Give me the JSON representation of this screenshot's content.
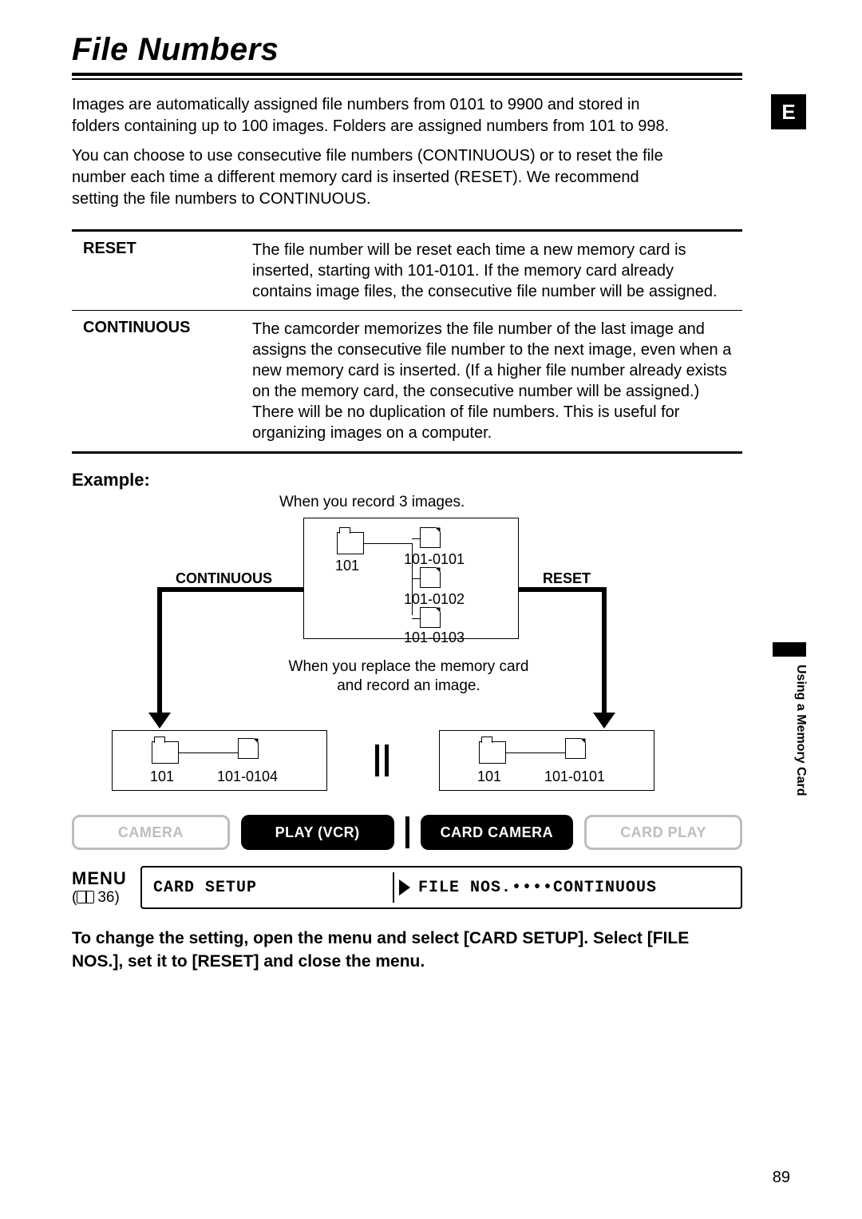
{
  "title": "File Numbers",
  "lang_tab": "E",
  "intro": {
    "p1": "Images are automatically assigned file numbers from 0101 to 9900 and stored in folders containing up to 100 images. Folders are assigned numbers from 101 to 998.",
    "p2": "You can choose to use consecutive file numbers (CONTINUOUS) or to reset the file number each time a different memory card is inserted (RESET). We recommend setting the file numbers to CONTINUOUS."
  },
  "table": {
    "rows": [
      {
        "term": "RESET",
        "desc": "The file number will be reset each time a new memory card is inserted, starting with 101-0101. If the memory card already contains image files, the consecutive file number will be assigned."
      },
      {
        "term": "CONTINUOUS",
        "desc": "The camcorder memorizes the file number of the last image and assigns the consecutive file number to the next image, even when a new memory card is inserted. (If a higher file number already exists on the memory card, the consecutive number will be assigned.) There will be no duplication of file numbers. This is useful for organizing images on a computer."
      }
    ]
  },
  "example": {
    "label": "Example:",
    "caption_top": "When you record 3 images.",
    "continuous_label": "CONTINUOUS",
    "reset_label": "RESET",
    "folder_num": "101",
    "files": [
      "101-0101",
      "101-0102",
      "101-0103"
    ],
    "caption_mid_l1": "When you replace the memory card",
    "caption_mid_l2": "and record an image.",
    "left_folder": "101",
    "left_file": "101-0104",
    "right_folder": "101",
    "right_file": "101-0101"
  },
  "modes": [
    "CAMERA",
    "PLAY (VCR)",
    "CARD CAMERA",
    "CARD PLAY"
  ],
  "menu": {
    "label": "MENU",
    "ref": "36",
    "left": "CARD SETUP",
    "right": "FILE NOS.••••CONTINUOUS"
  },
  "instruction": "To change the setting, open the menu and select [CARD SETUP]. Select [FILE NOS.], set it to [RESET] and close the menu.",
  "side_label": "Using a Memory Card",
  "page_number": "89"
}
